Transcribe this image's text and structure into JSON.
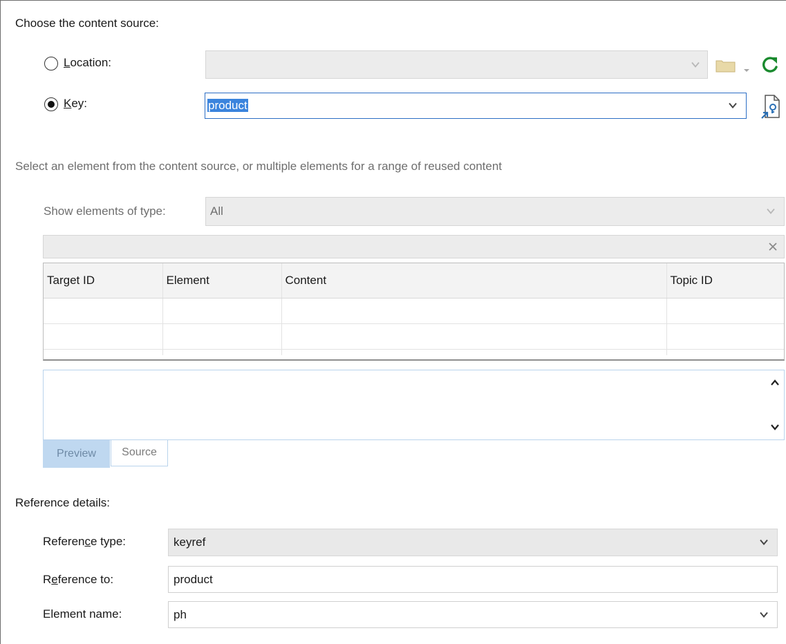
{
  "content_source": {
    "heading": "Choose the content source:",
    "location_label": "Location:",
    "location_underline": "L",
    "location_rest": "ocation:",
    "location_value": "",
    "key_underline": "K",
    "key_rest": "ey:",
    "key_value": "product",
    "location_selected": false,
    "key_selected": true
  },
  "select_section": {
    "instruction": "Select an element from the content source, or multiple elements for a range of reused content",
    "show_elements_label": "Show elements of type:",
    "show_elements_value": "All",
    "filter_value": ""
  },
  "table": {
    "columns": [
      "Target ID",
      "Element",
      "Content",
      "Topic ID"
    ],
    "rows": []
  },
  "preview_tabs": {
    "preview": "Preview",
    "source": "Source",
    "active": "Preview"
  },
  "reference_details": {
    "heading": "Reference details:",
    "type_label_pre": "Referen",
    "type_label_u": "c",
    "type_label_post": "e type:",
    "type_value": "keyref",
    "to_label_pre": "R",
    "to_label_u": "e",
    "to_label_post": "ference to:",
    "to_value": "product",
    "element_label": "Element name:",
    "element_value": "ph"
  },
  "icons": {
    "folder": "folder-icon",
    "refresh": "refresh-icon",
    "key_reference": "key-reference-icon",
    "clear": "clear-icon"
  },
  "colors": {
    "refresh_green": "#1a8a2e",
    "selection_blue": "#3b84dd",
    "folder_tan": "#e8d9a8"
  }
}
